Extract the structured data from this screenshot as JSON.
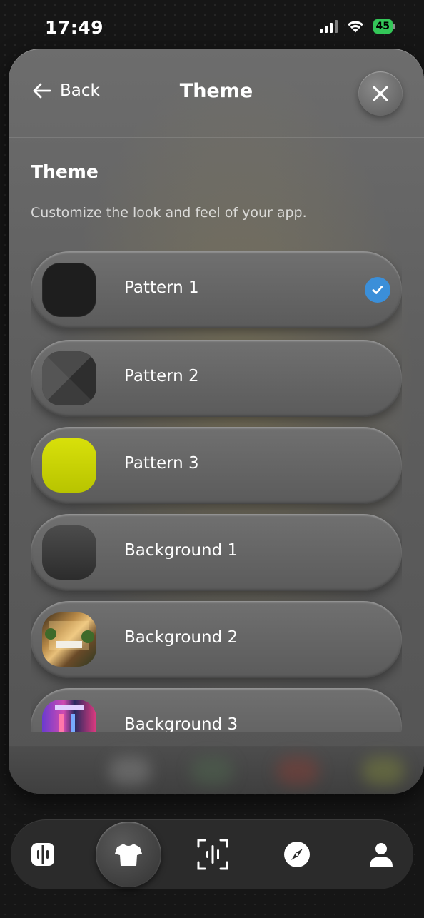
{
  "status_bar": {
    "time": "17:49",
    "battery": "45",
    "signal_icon": "cellular-signal-icon",
    "wifi_icon": "wifi-icon"
  },
  "header": {
    "back_label": "Back",
    "title": "Theme",
    "close_icon": "close-icon"
  },
  "section": {
    "title": "Theme",
    "description": "Customize the look and feel of your app."
  },
  "theme_options": [
    {
      "label": "Pattern 1",
      "selected": true,
      "swatch": "#1e1e1e"
    },
    {
      "label": "Pattern 2",
      "selected": false,
      "swatch": "#3a3a3a"
    },
    {
      "label": "Pattern 3",
      "selected": false,
      "swatch": "#c8d000"
    },
    {
      "label": "Background 1",
      "selected": false,
      "swatch": "#3c3c3c"
    },
    {
      "label": "Background 2",
      "selected": false,
      "swatch": "image-room"
    },
    {
      "label": "Background 3",
      "selected": false,
      "swatch": "image-neon-closet"
    }
  ],
  "colors": {
    "check_accent": "#3b8fd9",
    "battery_green": "#34c759"
  },
  "bottom_nav": {
    "items": [
      {
        "icon": "split-view-icon",
        "active": false
      },
      {
        "icon": "tshirt-icon",
        "active": true
      },
      {
        "icon": "voice-scan-icon",
        "active": false
      },
      {
        "icon": "compass-icon",
        "active": false
      },
      {
        "icon": "profile-icon",
        "active": false
      }
    ]
  }
}
